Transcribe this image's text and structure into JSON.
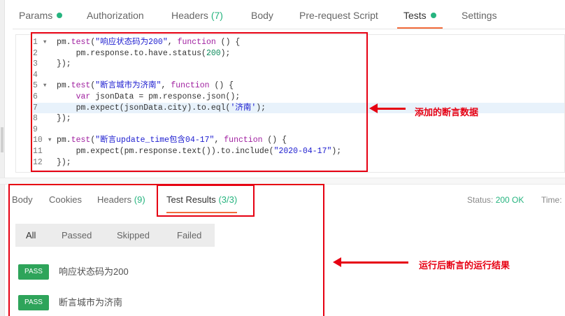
{
  "request_tabs": [
    {
      "label": "Params"
    },
    {
      "label": "Authorization"
    },
    {
      "label": "Headers",
      "count": "(7)"
    },
    {
      "label": "Body"
    },
    {
      "label": "Pre-request Script"
    },
    {
      "label": "Tests"
    },
    {
      "label": "Settings"
    }
  ],
  "active_request_tab": "Tests",
  "editor": {
    "lines": [
      {
        "n": "1",
        "fold": true,
        "tokens": [
          [
            "obj",
            "pm."
          ],
          [
            "fn",
            "test"
          ],
          [
            "plain",
            "("
          ],
          [
            "str",
            "\"响应状态码为200\""
          ],
          [
            "plain",
            ", "
          ],
          [
            "kw",
            "function"
          ],
          [
            "plain",
            " () {"
          ]
        ]
      },
      {
        "n": "2",
        "fold": false,
        "tokens": [
          [
            "plain",
            "    pm.response.to.have.status("
          ],
          [
            "num",
            "200"
          ],
          [
            "plain",
            ");"
          ]
        ]
      },
      {
        "n": "3",
        "fold": false,
        "tokens": [
          [
            "plain",
            "});"
          ]
        ]
      },
      {
        "n": "4",
        "fold": false,
        "tokens": []
      },
      {
        "n": "5",
        "fold": true,
        "tokens": [
          [
            "obj",
            "pm."
          ],
          [
            "fn",
            "test"
          ],
          [
            "plain",
            "("
          ],
          [
            "str",
            "\"断言城市为济南\""
          ],
          [
            "plain",
            ", "
          ],
          [
            "kw",
            "function"
          ],
          [
            "plain",
            " () {"
          ]
        ]
      },
      {
        "n": "6",
        "fold": false,
        "tokens": [
          [
            "plain",
            "    "
          ],
          [
            "kw",
            "var"
          ],
          [
            "plain",
            " jsonData = pm.response.json();"
          ]
        ]
      },
      {
        "n": "7",
        "fold": false,
        "tokens": [
          [
            "plain",
            "    pm.expect(jsonData.city).to.eql("
          ],
          [
            "str",
            "'济南'"
          ],
          [
            "plain",
            ");"
          ]
        ]
      },
      {
        "n": "8",
        "fold": false,
        "tokens": [
          [
            "plain",
            "});"
          ]
        ]
      },
      {
        "n": "9",
        "fold": false,
        "tokens": []
      },
      {
        "n": "10",
        "fold": true,
        "tokens": [
          [
            "obj",
            "pm."
          ],
          [
            "fn",
            "test"
          ],
          [
            "plain",
            "("
          ],
          [
            "str",
            "\"断言update_time包含04-17\""
          ],
          [
            "plain",
            ", "
          ],
          [
            "kw",
            "function"
          ],
          [
            "plain",
            " () {"
          ]
        ]
      },
      {
        "n": "11",
        "fold": false,
        "tokens": [
          [
            "plain",
            "    pm.expect(pm.response.text()).to.include("
          ],
          [
            "str",
            "\"2020-04-17\""
          ],
          [
            "plain",
            ");"
          ]
        ]
      },
      {
        "n": "12",
        "fold": false,
        "tokens": [
          [
            "plain",
            "});"
          ]
        ]
      }
    ],
    "highlighted_line": "7"
  },
  "annotations": {
    "added_assertion": "添加的断言数据",
    "run_result": "运行后断言的运行结果"
  },
  "response_tabs": [
    {
      "label": "Body"
    },
    {
      "label": "Cookies"
    },
    {
      "label": "Headers",
      "count": "(9)"
    },
    {
      "label": "Test Results",
      "count": "(3/3)"
    }
  ],
  "status": {
    "label": "Status:",
    "value": "200 OK",
    "time_label": "Time:"
  },
  "filters": [
    "All",
    "Passed",
    "Skipped",
    "Failed"
  ],
  "results": [
    {
      "badge": "PASS",
      "text": "响应状态码为200"
    },
    {
      "badge": "PASS",
      "text": "断言城市为济南"
    }
  ],
  "colors": {
    "accent": "#f26b3a",
    "success": "#26b47f",
    "pass_badge": "#2ea45a",
    "annotation": "#e60012"
  }
}
